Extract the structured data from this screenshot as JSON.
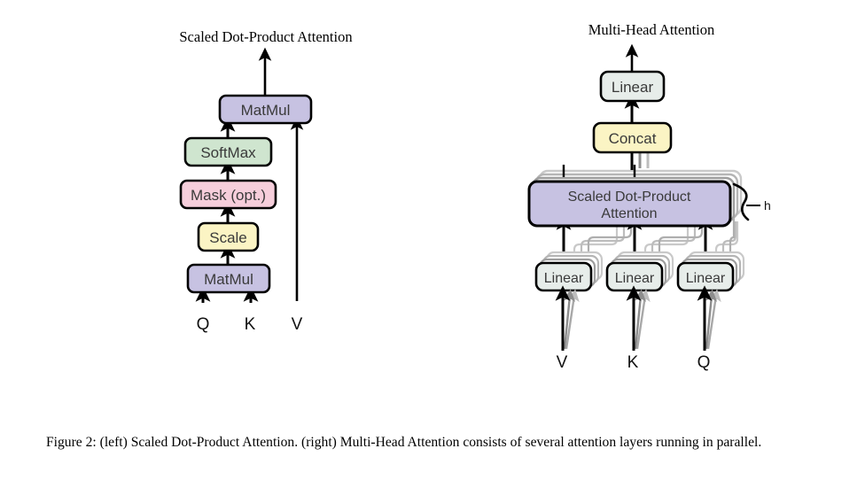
{
  "figure": {
    "panels": {
      "left": {
        "title": "Scaled Dot-Product Attention",
        "boxes": [
          {
            "label": "MatMul",
            "color": "#c7c2e2"
          },
          {
            "label": "SoftMax",
            "color": "#cfe5cf"
          },
          {
            "label": "Mask (opt.)",
            "color": "#f6cedb"
          },
          {
            "label": "Scale",
            "color": "#fbf4c4"
          },
          {
            "label": "MatMul",
            "color": "#c7c2e2"
          }
        ],
        "inputs": [
          "Q",
          "K",
          "V"
        ]
      },
      "right": {
        "title": "Multi-Head Attention",
        "boxes": [
          {
            "label": "Linear",
            "color": "#e7edea"
          },
          {
            "label": "Concat",
            "color": "#fbf4c4"
          },
          {
            "label": "Scaled Dot-Product",
            "label2": "Attention",
            "color": "#c7c2e2"
          },
          {
            "label": "Linear",
            "color": "#e7edea"
          },
          {
            "label": "Linear",
            "color": "#e7edea"
          },
          {
            "label": "Linear",
            "color": "#e7edea"
          }
        ],
        "heads_label": "h",
        "inputs": [
          "V",
          "K",
          "Q"
        ]
      }
    },
    "caption": {
      "lead": "Figure 2:",
      "text": " (left) Scaled Dot-Product Attention.  (right) Multi-Head Attention consists of several attention layers running in parallel."
    },
    "colors": {
      "purple": "#c7c2e2",
      "green": "#cfe5cf",
      "pink": "#f6cedb",
      "yellow": "#fbf4c4",
      "gray": "#e7edea",
      "outline": "#000000",
      "ghost": "#b8b8b8"
    }
  }
}
